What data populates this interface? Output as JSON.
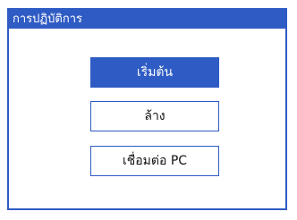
{
  "window": {
    "title": "การปฏิบัติการ"
  },
  "actions": {
    "start_label": "เริ่มต้น",
    "clear_label": "ล้าง",
    "connect_label": "เชื่อมต่อ PC"
  },
  "colors": {
    "accent": "#2f5bc4",
    "background": "#ffffff",
    "text": "#111111"
  }
}
